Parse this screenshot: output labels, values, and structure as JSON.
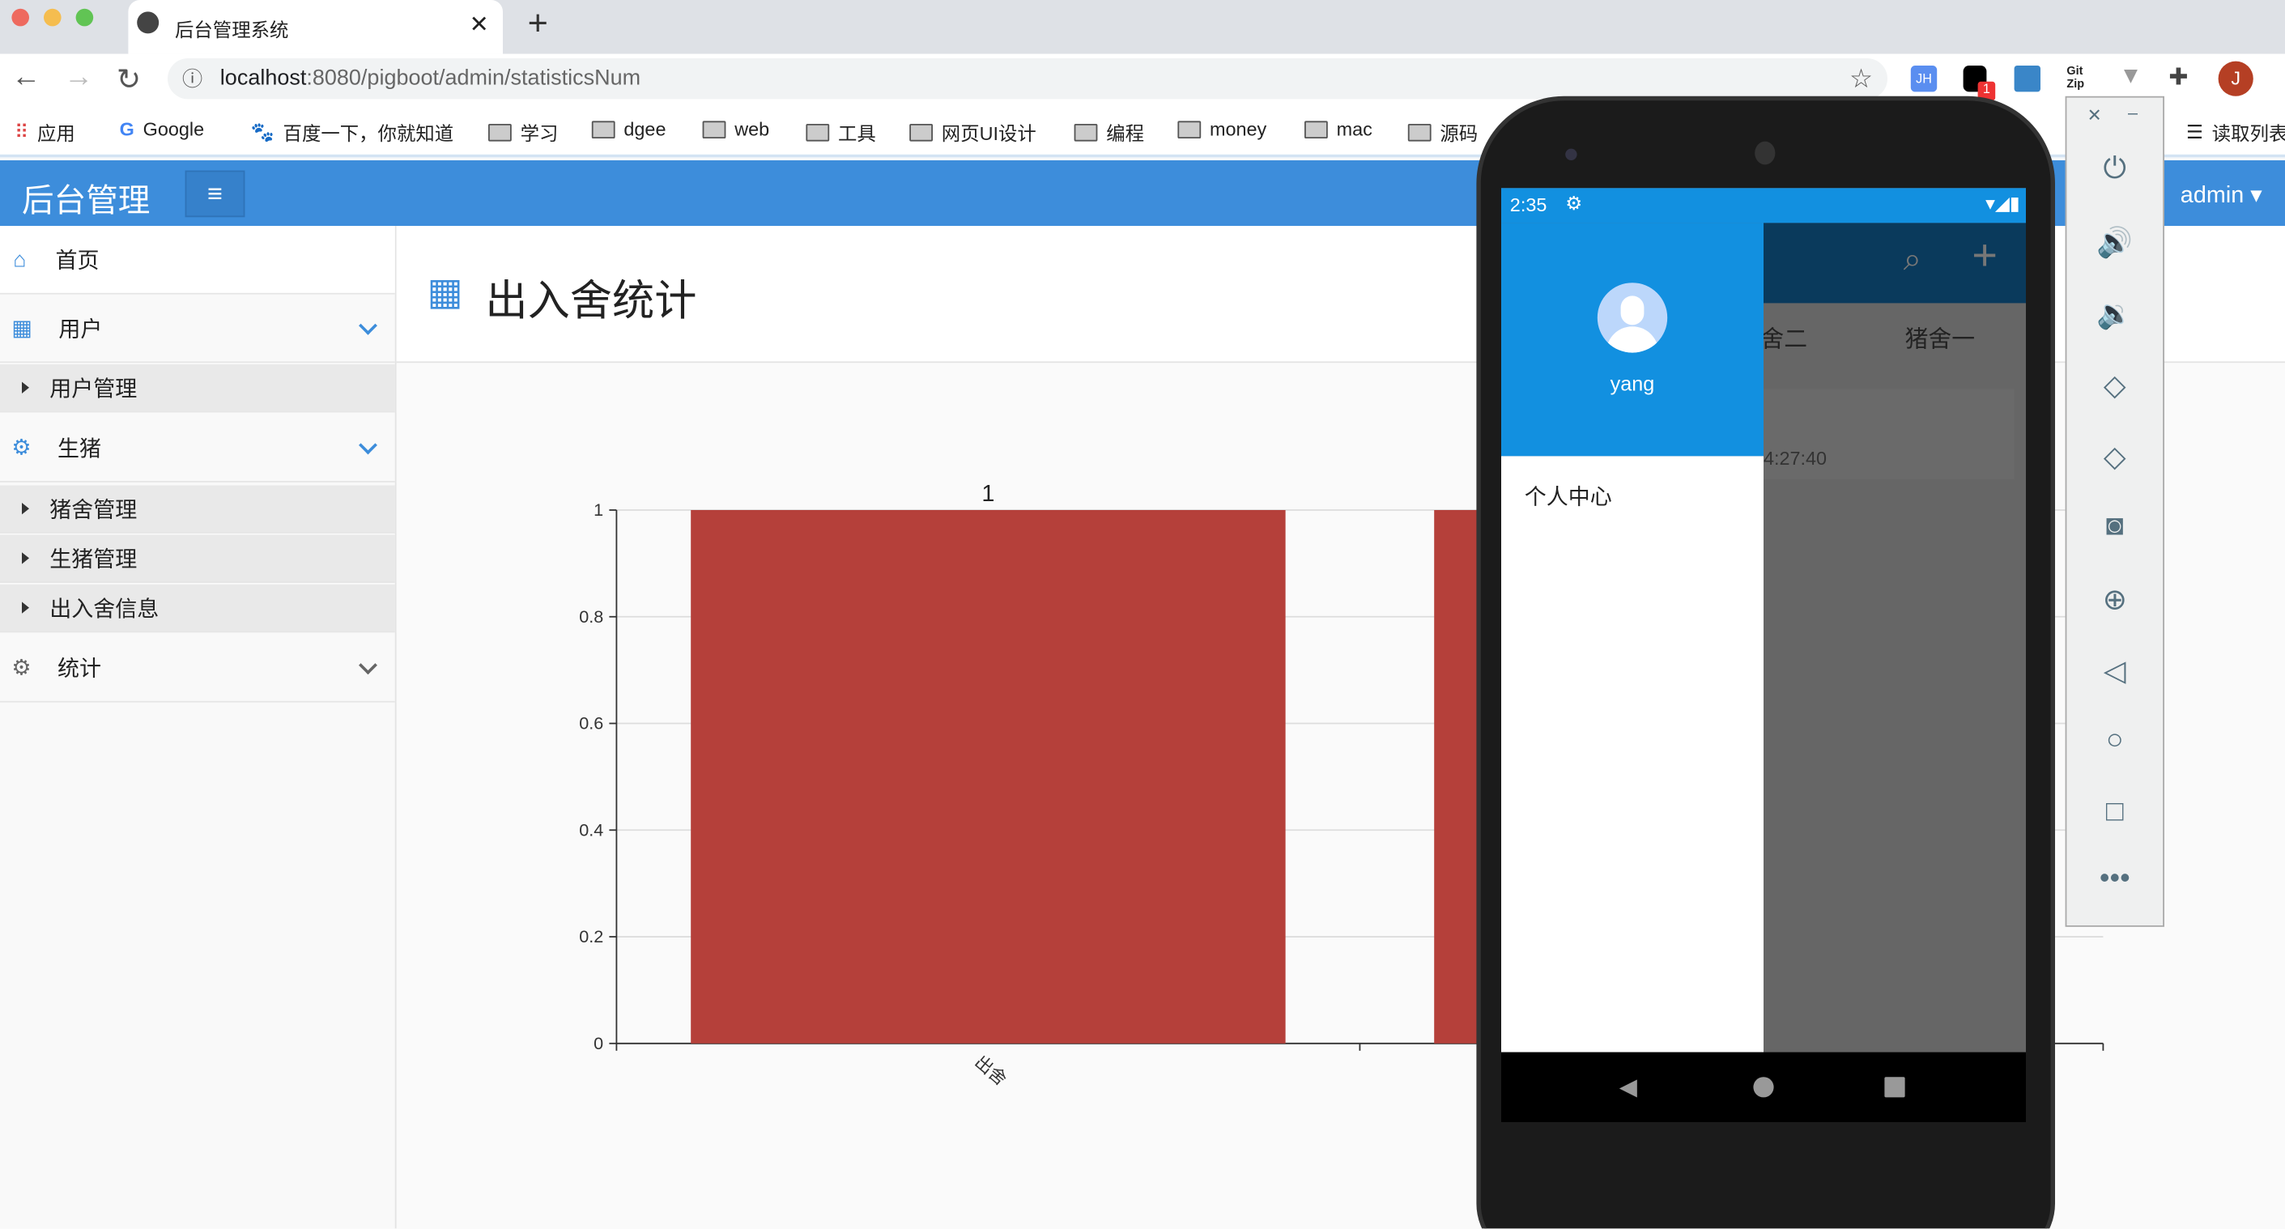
{
  "browser": {
    "tab_title": "后台管理系统",
    "url_host": "localhost",
    "url_rest": ":8080/pigboot/admin/statisticsNum",
    "ext_badge": "1",
    "profile_initial": "J",
    "reading_list": "读取列表",
    "bookmarks": [
      "应用",
      "Google",
      "百度一下，你就知道",
      "学习",
      "dgee",
      "web",
      "工具",
      "网页UI设计",
      "编程",
      "money",
      "mac",
      "源码"
    ]
  },
  "app": {
    "title": "后台管理",
    "user": "admin",
    "page_title": "出入舍统计",
    "sidebar": [
      {
        "label": "首页"
      },
      {
        "label": "用户"
      },
      {
        "label": "用户管理"
      },
      {
        "label": "生猪"
      },
      {
        "label": "猪舍管理"
      },
      {
        "label": "生猪管理"
      },
      {
        "label": "出入舍信息"
      },
      {
        "label": "统计"
      }
    ]
  },
  "chart_data": {
    "type": "bar",
    "categories": [
      "出舍",
      ""
    ],
    "values": [
      1,
      1
    ],
    "data_labels": [
      "1",
      ""
    ],
    "ylim": [
      0,
      1
    ],
    "yticks": [
      "0",
      "0.2",
      "0.4",
      "0.6",
      "0.8",
      "1"
    ],
    "bar_color": "#b5403a",
    "grid": true
  },
  "phone": {
    "time": "2:35",
    "username": "yang",
    "menu_item": "个人中心",
    "tab_partial": "舍二",
    "tab_full": "猪舍一",
    "time_partial": "4:27:40"
  }
}
